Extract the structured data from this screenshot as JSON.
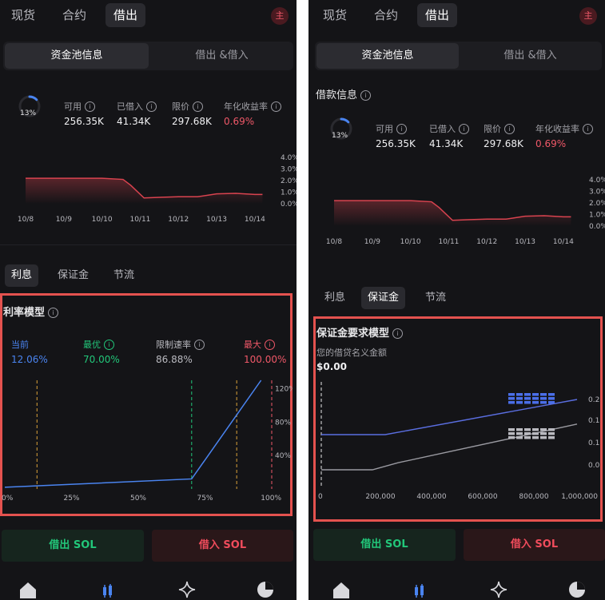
{
  "left": {
    "nav": {
      "tabs": [
        "现货",
        "合约",
        "借出"
      ],
      "active": 2,
      "avatar": "主"
    },
    "segments": [
      "资金池信息",
      "借出 &借入"
    ],
    "gauge": {
      "percent_label": "13%",
      "fraction": 0.13
    },
    "stats": [
      {
        "label": "可用",
        "value": "256.35K"
      },
      {
        "label": "已借入",
        "value": "41.34K"
      },
      {
        "label": "限价",
        "value": "297.68K"
      },
      {
        "label": "年化收益率",
        "value": "0.69%"
      }
    ],
    "history_chart": {
      "type": "line",
      "x_labels": [
        "10/8",
        "10/9",
        "10/10",
        "10/11",
        "10/12",
        "10/13",
        "10/14"
      ],
      "y_labels": [
        "4.0%",
        "3.0%",
        "2.0%",
        "1.0%",
        "0.0%"
      ],
      "ylim": [
        0,
        4
      ],
      "x": [
        0,
        0.55,
        1.0,
        1.15,
        1.6,
        2.0,
        2.55,
        2.75,
        3.1,
        3.5,
        4.0,
        4.5,
        5.0,
        5.5,
        6.0,
        6.2
      ],
      "y": [
        2.2,
        2.2,
        2.2,
        2.2,
        2.2,
        2.2,
        2.1,
        1.6,
        0.5,
        0.55,
        0.6,
        0.6,
        0.85,
        0.9,
        0.8,
        0.8
      ],
      "line_color": "#d9434f"
    },
    "subtabs": [
      "利息",
      "保证金",
      "节流"
    ],
    "subtab_active": 0,
    "rate_model": {
      "title": "利率模型",
      "cols": [
        {
          "label": "当前",
          "value": "12.06%",
          "color": "#4a84f0"
        },
        {
          "label": "最优",
          "value": "70.00%",
          "color": "#22c77a"
        },
        {
          "label": "限制速率",
          "value": "86.88%",
          "color": "#b9b9bf"
        },
        {
          "label": "最大",
          "value": "100.00%",
          "color": "#ef5868"
        }
      ],
      "chart_data": {
        "type": "line",
        "x_labels": [
          "0%",
          "25%",
          "50%",
          "75%",
          "100%"
        ],
        "y_labels": [
          "120%",
          "80%",
          "40%"
        ],
        "x": [
          0,
          70,
          96
        ],
        "y": [
          2,
          12,
          130
        ],
        "xlim": [
          0,
          100
        ],
        "ylim": [
          0,
          130
        ],
        "markers": [
          {
            "x": 12.06,
            "color": "#d9a13a"
          },
          {
            "x": 70,
            "color": "#22c77a"
          },
          {
            "x": 86.88,
            "color": "#d9a13a"
          },
          {
            "x": 100,
            "color": "#ef5868"
          }
        ]
      }
    },
    "actions": {
      "lend": "借出 SOL",
      "borrow": "借入 SOL"
    }
  },
  "right": {
    "nav": {
      "tabs": [
        "现货",
        "合约",
        "借出"
      ],
      "active": 2,
      "avatar": "主"
    },
    "segments": [
      "资金池信息",
      "借出 &借入"
    ],
    "borrow_info_title": "借款信息",
    "gauge": {
      "percent_label": "13%",
      "fraction": 0.13
    },
    "stats": [
      {
        "label": "可用",
        "value": "256.35K"
      },
      {
        "label": "已借入",
        "value": "41.34K"
      },
      {
        "label": "限价",
        "value": "297.68K"
      },
      {
        "label": "年化收益率",
        "value": "0.69%"
      }
    ],
    "history_chart": {
      "type": "line",
      "x_labels": [
        "10/8",
        "10/9",
        "10/10",
        "10/11",
        "10/12",
        "10/13",
        "10/14"
      ],
      "y_labels": [
        "4.0%",
        "3.0%",
        "2.0%",
        "1.0%",
        "0.0%"
      ],
      "ylim": [
        0,
        4
      ],
      "x": [
        0,
        0.55,
        1.0,
        1.15,
        1.6,
        2.0,
        2.55,
        2.75,
        3.1,
        3.5,
        4.0,
        4.5,
        5.0,
        5.5,
        6.0,
        6.2
      ],
      "y": [
        2.2,
        2.2,
        2.2,
        2.2,
        2.2,
        2.2,
        2.1,
        1.6,
        0.5,
        0.55,
        0.6,
        0.6,
        0.85,
        0.9,
        0.8,
        0.8
      ],
      "line_color": "#d9434f"
    },
    "subtabs": [
      "利息",
      "保证金",
      "节流"
    ],
    "subtab_active": 1,
    "margin_model": {
      "title": "保证金要求模型",
      "subtitle": "您的借贷名义金额",
      "amount": "$0.00",
      "chart_data": {
        "type": "line",
        "x_labels": [
          "0",
          "200,000",
          "400,000",
          "600,000",
          "800,000",
          "1,000,000"
        ],
        "y_labels": [
          "0.2",
          "0.1",
          "0.1",
          "0.0"
        ],
        "xlim": [
          0,
          1000000
        ],
        "ylim": [
          0,
          0.2
        ],
        "series": [
          {
            "x": [
              0,
              250000,
              1000000
            ],
            "y": [
              0.1,
              0.1,
              0.2
            ],
            "color": "#5a6ee0"
          },
          {
            "x": [
              0,
              200000,
              300000,
              1000000
            ],
            "y": [
              0.0,
              0.0,
              0.02,
              0.13
            ],
            "color": "#9a9aa1"
          }
        ]
      }
    },
    "actions": {
      "lend": "借出 SOL",
      "borrow": "借入 SOL"
    }
  },
  "icons": [
    "home-icon",
    "candlestick-icon",
    "sparkle-icon",
    "pie-chart-icon"
  ]
}
